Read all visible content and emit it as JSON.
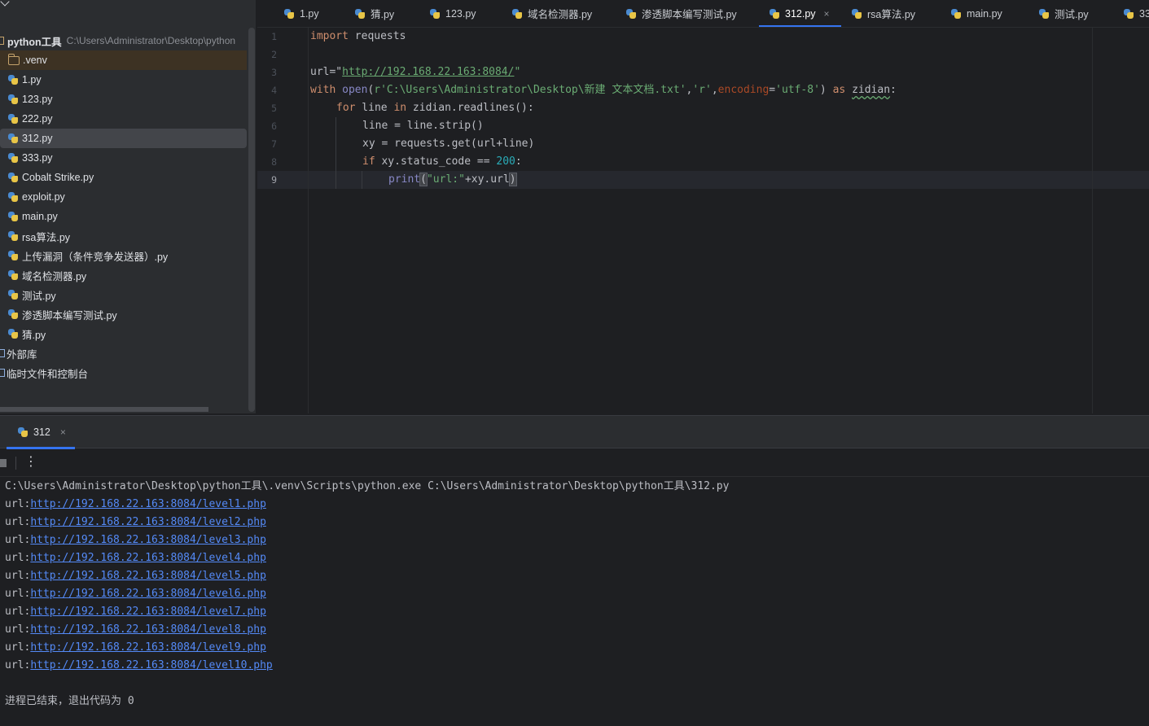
{
  "project": {
    "name": "python工具",
    "path": "C:\\Users\\Administrator\\Desktop\\python",
    "items": [
      {
        "label": ".venv",
        "type": "folder"
      },
      {
        "label": "1.py",
        "type": "py"
      },
      {
        "label": "123.py",
        "type": "py"
      },
      {
        "label": "222.py",
        "type": "py"
      },
      {
        "label": "312.py",
        "type": "py",
        "selected": true
      },
      {
        "label": "333.py",
        "type": "py"
      },
      {
        "label": "Cobalt Strike.py",
        "type": "py"
      },
      {
        "label": "exploit.py",
        "type": "py"
      },
      {
        "label": "main.py",
        "type": "py"
      },
      {
        "label": "rsa算法.py",
        "type": "py"
      },
      {
        "label": "上传漏洞（条件竞争发送器）.py",
        "type": "py"
      },
      {
        "label": "域名检测器.py",
        "type": "py"
      },
      {
        "label": "测试.py",
        "type": "py"
      },
      {
        "label": "渗透脚本编写测试.py",
        "type": "py"
      },
      {
        "label": "猜.py",
        "type": "py"
      }
    ],
    "external_libraries": "外部库",
    "scratches": "临时文件和控制台"
  },
  "tabs": [
    {
      "label": "1.py"
    },
    {
      "label": "猜.py"
    },
    {
      "label": "123.py"
    },
    {
      "label": "域名检测器.py"
    },
    {
      "label": "渗透脚本编写测试.py"
    },
    {
      "label": "312.py",
      "active": true
    },
    {
      "label": "rsa算法.py"
    },
    {
      "label": "main.py"
    },
    {
      "label": "测试.py"
    },
    {
      "label": "33"
    }
  ],
  "tab_close_glyph": "×",
  "editor": {
    "line_numbers": [
      "1",
      "2",
      "3",
      "4",
      "5",
      "6",
      "7",
      "8",
      "9"
    ],
    "current_line": "9",
    "code": {
      "l1_kw": "import",
      "l1_rest": " requests",
      "l3_a": "url=\"",
      "l3_url": "http://192.168.22.163:8084/",
      "l3_b": "\"",
      "l4_kw": "with",
      "l4_fn": "open",
      "l4_p1": "(",
      "l4_str": "r'C:\\Users\\Administrator\\Desktop\\新建 文本文档.txt'",
      "l4_c1": ",",
      "l4_str2": "'r'",
      "l4_c2": ",",
      "l4_param": "encoding",
      "l4_eq": "=",
      "l4_str3": "'utf-8'",
      "l4_p2": ") ",
      "l4_as": "as",
      "l4_sp": " ",
      "l4_var": "zidian",
      "l4_colon": ":",
      "l5_kw": "for",
      "l5_a": " line ",
      "l5_in": "in",
      "l5_b": " zidian.readlines():",
      "l6": "line = line.strip()",
      "l7": "xy = requests.get(url+line)",
      "l8_kw": "if",
      "l8_a": " xy.status_code == ",
      "l8_num": "200",
      "l8_b": ":",
      "l9_fn": "print",
      "l9_p": "(",
      "l9_str": "\"url:\"",
      "l9_rest": "+xy.url",
      "l9_close": ")"
    }
  },
  "run": {
    "tab_label": "312",
    "command": "C:\\Users\\Administrator\\Desktop\\python工具\\.venv\\Scripts\\python.exe C:\\Users\\Administrator\\Desktop\\python工具\\312.py",
    "prefix": "url:",
    "links": [
      "http://192.168.22.163:8084/level1.php",
      "http://192.168.22.163:8084/level2.php",
      "http://192.168.22.163:8084/level3.php",
      "http://192.168.22.163:8084/level4.php",
      "http://192.168.22.163:8084/level5.php",
      "http://192.168.22.163:8084/level6.php",
      "http://192.168.22.163:8084/level7.php",
      "http://192.168.22.163:8084/level8.php",
      "http://192.168.22.163:8084/level9.php",
      "http://192.168.22.163:8084/level10.php"
    ],
    "exit_message": "进程已结束，退出代码为 0",
    "more_glyph": "⋮"
  },
  "colors": {
    "accent": "#3574f0",
    "keyword": "#cf8e6d",
    "string": "#6aab73",
    "number": "#2aacb8",
    "link": "#548af7"
  }
}
